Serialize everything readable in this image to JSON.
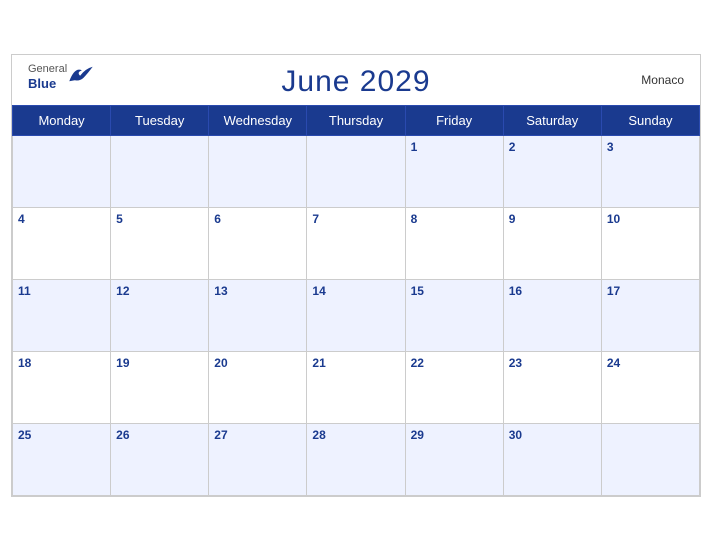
{
  "header": {
    "logo_general": "General",
    "logo_blue": "Blue",
    "title": "June 2029",
    "country": "Monaco"
  },
  "weekdays": [
    "Monday",
    "Tuesday",
    "Wednesday",
    "Thursday",
    "Friday",
    "Saturday",
    "Sunday"
  ],
  "weeks": [
    [
      "",
      "",
      "",
      "",
      "1",
      "2",
      "3"
    ],
    [
      "4",
      "5",
      "6",
      "7",
      "8",
      "9",
      "10"
    ],
    [
      "11",
      "12",
      "13",
      "14",
      "15",
      "16",
      "17"
    ],
    [
      "18",
      "19",
      "20",
      "21",
      "22",
      "23",
      "24"
    ],
    [
      "25",
      "26",
      "27",
      "28",
      "29",
      "30",
      ""
    ]
  ]
}
